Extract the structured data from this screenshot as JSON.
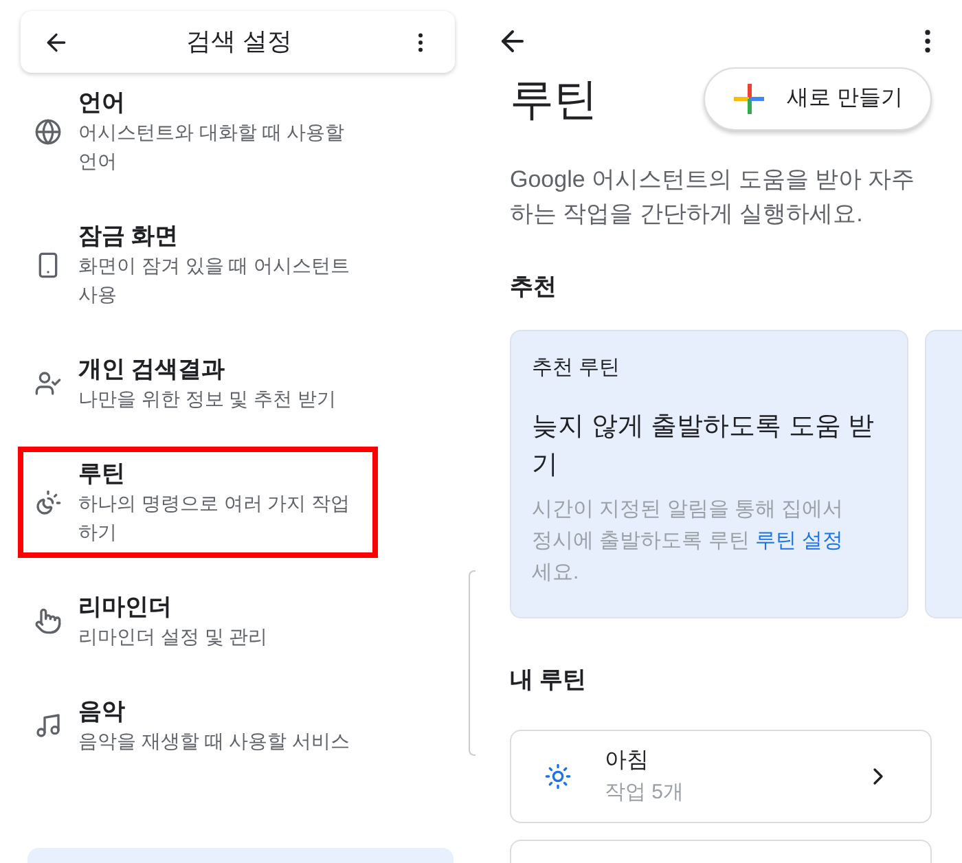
{
  "settings_screen": {
    "title": "검색 설정",
    "items": [
      {
        "kind": "globe",
        "title": "언어",
        "description": "어시스턴트와 대화할 때 사용할 언어",
        "selected": false
      },
      {
        "kind": "phone",
        "title": "잠금 화면",
        "description": "화면이 잠겨 있을 때 어시스턴트 사용",
        "selected": false
      },
      {
        "kind": "person",
        "title": "개인 검색결과",
        "description": "나만을 위한 정보 및 추천 받기",
        "selected": false
      },
      {
        "kind": "routine",
        "title": "루틴",
        "description": "하나의 명령으로 여러 가지 작업하기",
        "selected": true
      },
      {
        "kind": "hand",
        "title": "리마인더",
        "description": "리마인더 설정 및 관리",
        "selected": false
      },
      {
        "kind": "music",
        "title": "음악",
        "description": "음악을 재생할 때 사용할 서비스",
        "selected": false
      }
    ]
  },
  "routines_screen": {
    "title": "루틴",
    "new_button": "새로 만들기",
    "intro": "Google 어시스턴트의 도움을 받아 자주 하는 작업을 간단하게 실행하세요.",
    "recommended_heading": "추천",
    "recommended_cards": [
      {
        "label": "추천 루틴",
        "title": "늦지 않게 출발하도록 도움 받기",
        "description": "시간이 지정된 알림을 통해 집에서 정시에 출발하도록 루틴",
        "link": "루틴 설정",
        "suffix": "세요."
      }
    ],
    "my_routines_heading": "내 루틴",
    "my_routines": [
      {
        "name": "아침",
        "count": "작업 5개"
      }
    ]
  }
}
